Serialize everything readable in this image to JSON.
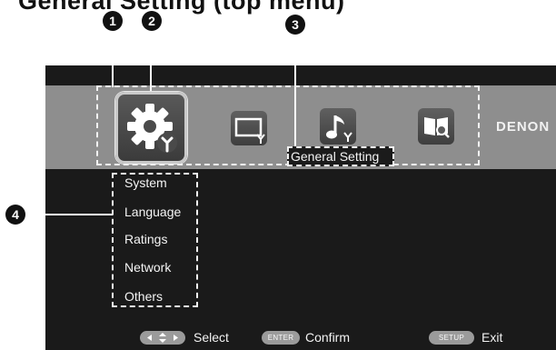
{
  "header": {
    "title": "General Setting (top menu)"
  },
  "callouts": {
    "c1": "1",
    "c2": "2",
    "c3": "3",
    "c4": "4"
  },
  "menu_bar": {
    "icons": [
      "settings-icon",
      "video-setup-icon",
      "audio-setup-icon",
      "manual-icon"
    ],
    "brand": "DENON",
    "selected_label": "General Setting"
  },
  "submenu": {
    "items": [
      "System",
      "Language",
      "Ratings",
      "Network",
      "Others"
    ]
  },
  "footer": {
    "select_label": "Select",
    "enter_key": "ENTER",
    "confirm_label": "Confirm",
    "setup_key": "SETUP",
    "exit_label": "Exit"
  },
  "colors": {
    "screen": "#1a1a1a",
    "band": "#8e8e8e",
    "text": "#f4f4f4"
  }
}
